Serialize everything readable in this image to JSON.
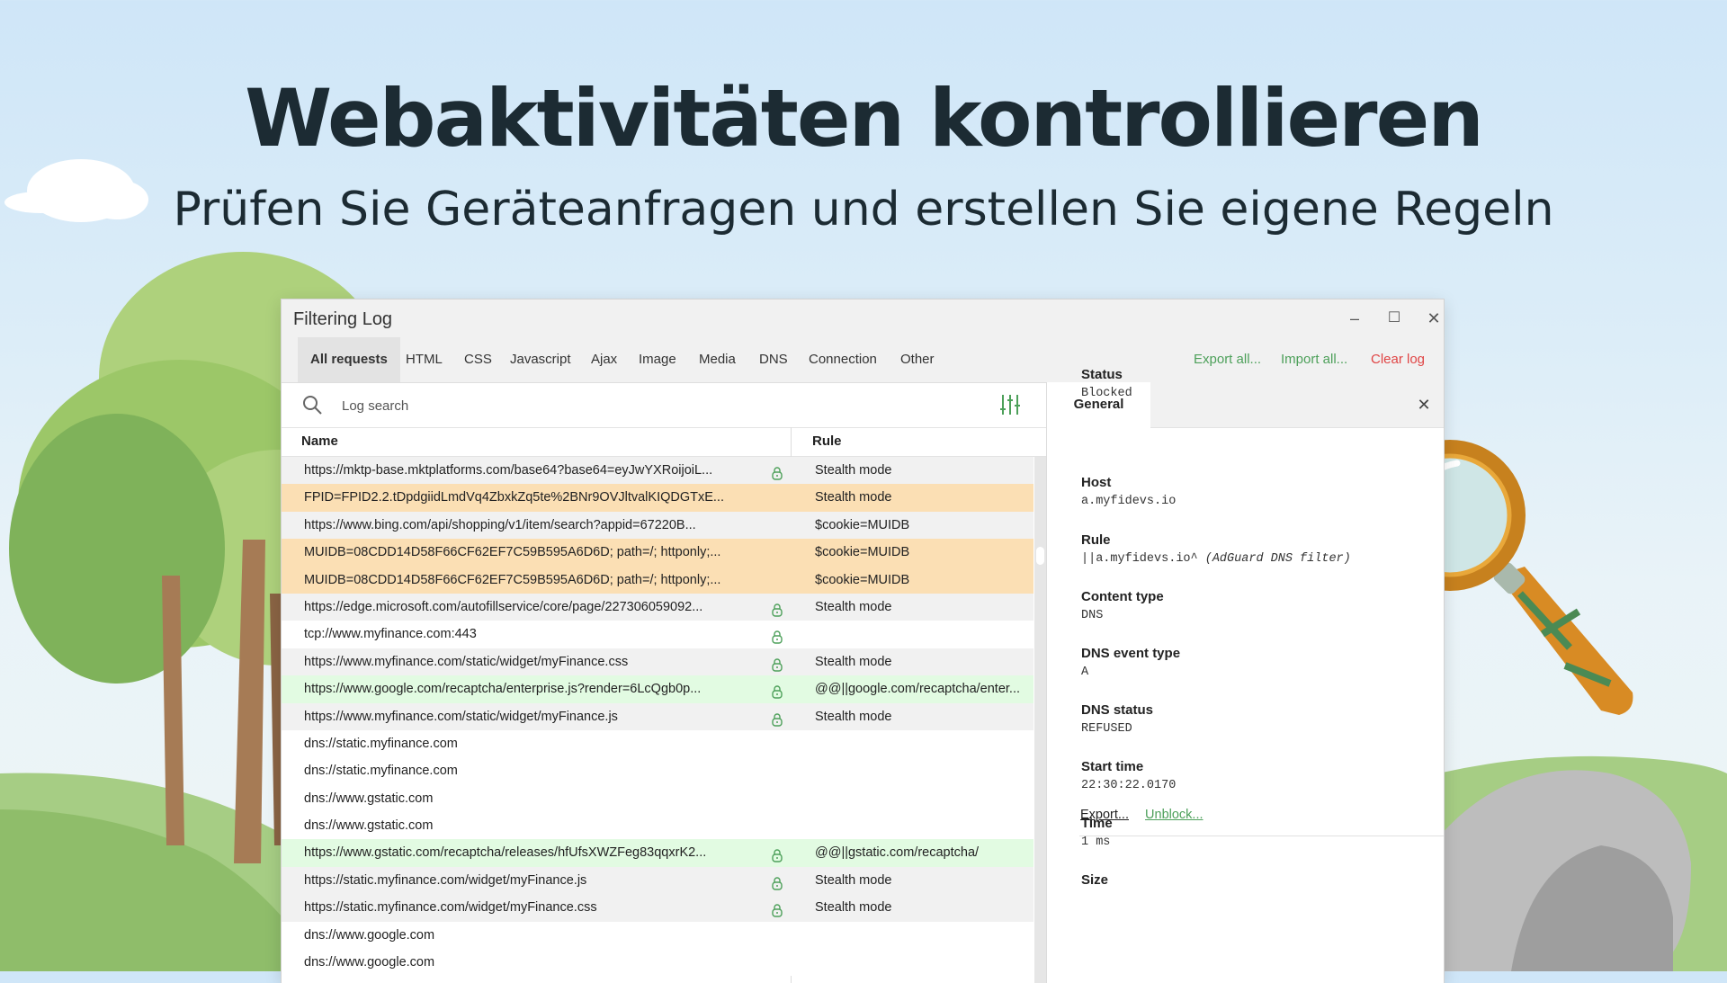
{
  "hero": {
    "title": "Webaktivitäten kontrollieren",
    "subtitle": "Prüfen Sie Geräteanfragen und erstellen Sie eigene Regeln"
  },
  "window": {
    "title": "Filtering Log",
    "controls": {
      "minimize": "–",
      "maximize": "☐",
      "close": "✕"
    }
  },
  "tabs": [
    "All requests",
    "HTML",
    "CSS",
    "Javascript",
    "Ajax",
    "Image",
    "Media",
    "DNS",
    "Connection",
    "Other"
  ],
  "actions": {
    "export_all": "Export all...",
    "import_all": "Import all...",
    "clear_log": "Clear log"
  },
  "search": {
    "placeholder": "Log search"
  },
  "table": {
    "columns": {
      "name": "Name",
      "rule": "Rule"
    },
    "rows": [
      {
        "name": "https://mktp-base.mktplatforms.com/base64?base64=eyJwYXRoijoiL...",
        "rule": "Stealth mode",
        "lock": true,
        "status": "gray"
      },
      {
        "name": "FPID=FPID2.2.tDpdgiidLmdVq4ZbxkZq5te%2BNr9OVJltvalKIQDGTxE...",
        "rule": "Stealth mode",
        "lock": false,
        "status": "orange"
      },
      {
        "name": "https://www.bing.com/api/shopping/v1/item/search?appid=67220B...",
        "rule": "$cookie=MUIDB",
        "lock": false,
        "status": "gray"
      },
      {
        "name": "MUIDB=08CDD14D58F66CF62EF7C59B595A6D6D; path=/; httponly;...",
        "rule": "$cookie=MUIDB",
        "lock": false,
        "status": "orange"
      },
      {
        "name": "MUIDB=08CDD14D58F66CF62EF7C59B595A6D6D; path=/; httponly;...",
        "rule": "$cookie=MUIDB",
        "lock": false,
        "status": "orange"
      },
      {
        "name": "https://edge.microsoft.com/autofillservice/core/page/227306059092...",
        "rule": "Stealth mode",
        "lock": true,
        "status": "gray"
      },
      {
        "name": "tcp://www.myfinance.com:443",
        "rule": "",
        "lock": true,
        "status": "white"
      },
      {
        "name": "https://www.myfinance.com/static/widget/myFinance.css",
        "rule": "Stealth mode",
        "lock": true,
        "status": "gray"
      },
      {
        "name": "https://www.google.com/recaptcha/enterprise.js?render=6LcQgb0p...",
        "rule": "@@||google.com/recaptcha/enter...",
        "lock": true,
        "status": "green"
      },
      {
        "name": "https://www.myfinance.com/static/widget/myFinance.js",
        "rule": "Stealth mode",
        "lock": true,
        "status": "gray"
      },
      {
        "name": "dns://static.myfinance.com",
        "rule": "",
        "lock": false,
        "status": "white"
      },
      {
        "name": "dns://static.myfinance.com",
        "rule": "",
        "lock": false,
        "status": "white"
      },
      {
        "name": "dns://www.gstatic.com",
        "rule": "",
        "lock": false,
        "status": "white"
      },
      {
        "name": "dns://www.gstatic.com",
        "rule": "",
        "lock": false,
        "status": "white"
      },
      {
        "name": "https://www.gstatic.com/recaptcha/releases/hfUfsXWZFeg83qqxrK2...",
        "rule": "@@||gstatic.com/recaptcha/",
        "lock": true,
        "status": "green"
      },
      {
        "name": "https://static.myfinance.com/widget/myFinance.js",
        "rule": "Stealth mode",
        "lock": true,
        "status": "gray"
      },
      {
        "name": "https://static.myfinance.com/widget/myFinance.css",
        "rule": "Stealth mode",
        "lock": true,
        "status": "gray"
      },
      {
        "name": "dns://www.google.com",
        "rule": "",
        "lock": false,
        "status": "white"
      },
      {
        "name": "dns://www.google.com",
        "rule": "",
        "lock": false,
        "status": "white"
      }
    ]
  },
  "details": {
    "tab": "General",
    "close": "✕",
    "status": {
      "label": "Status",
      "value": "Blocked"
    },
    "links": {
      "export": "Export...",
      "unblock": "Unblock..."
    },
    "host": {
      "label": "Host",
      "value": "a.myfidevs.io"
    },
    "rule": {
      "label": "Rule",
      "value": "||a.myfidevs.io^",
      "filter": "(AdGuard DNS filter)"
    },
    "content_type": {
      "label": "Content type",
      "value": "DNS"
    },
    "dns_event_type": {
      "label": "DNS event type",
      "value": "A"
    },
    "dns_status": {
      "label": "DNS status",
      "value": "REFUSED"
    },
    "start_time": {
      "label": "Start time",
      "value": "22:30:22.0170"
    },
    "time": {
      "label": "Time",
      "value": "1 ms"
    },
    "size": {
      "label": "Size"
    }
  },
  "colors": {
    "row_gray": "#f1f1f1",
    "row_orange": "#fbdfb4",
    "row_green": "#e2fbe2",
    "action_green": "#4da05a",
    "action_red": "#e04545",
    "heading": "#1c2b33"
  }
}
